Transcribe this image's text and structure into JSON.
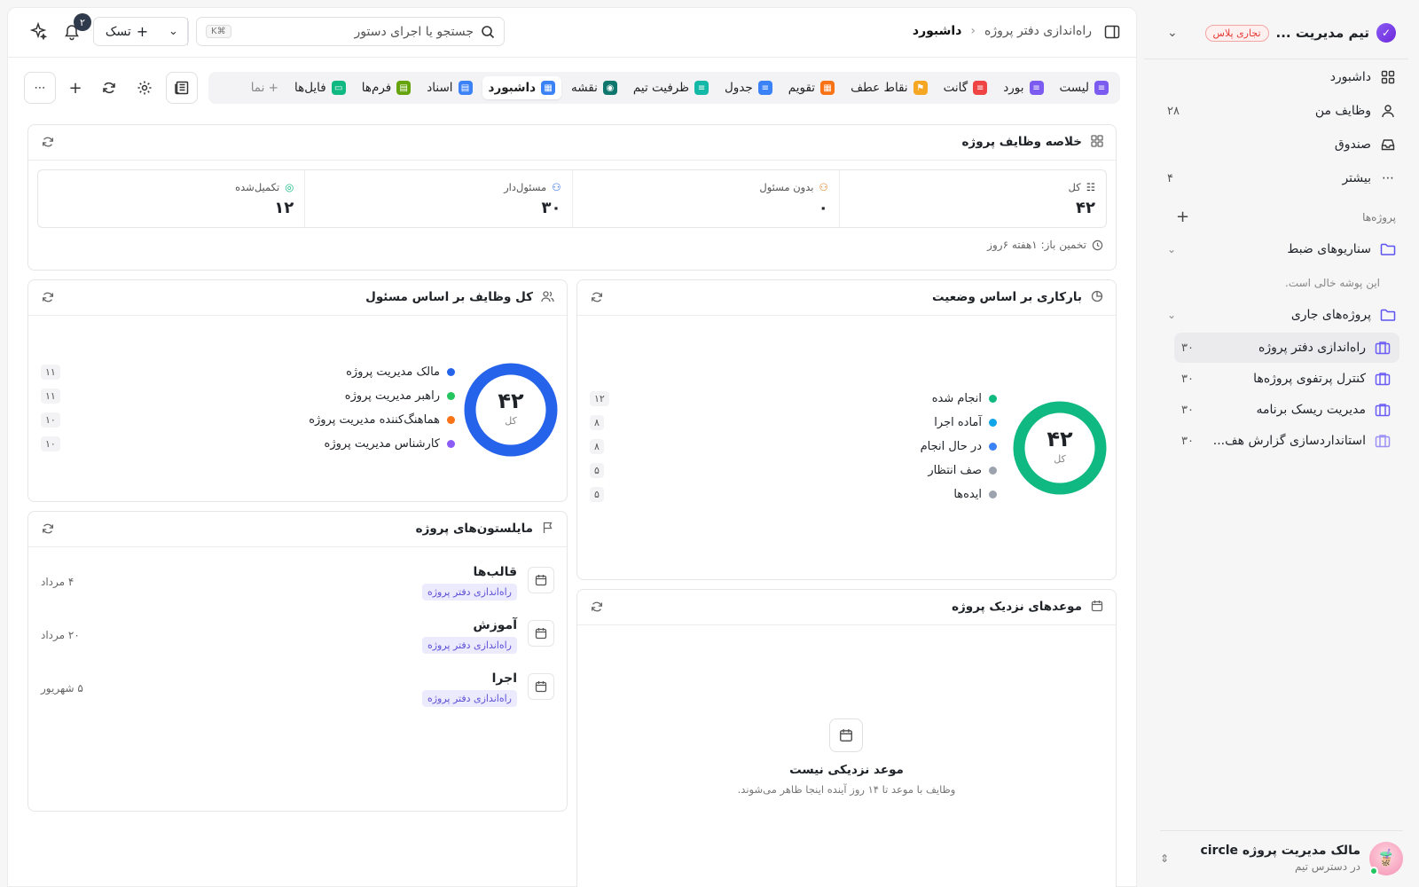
{
  "workspace": {
    "name": "تیم مدیریت ...",
    "badge": "تجاری پلاس"
  },
  "sidebar": {
    "nav": [
      {
        "label": "داشبورد",
        "count": ""
      },
      {
        "label": "وظایف من",
        "count": "۲۸"
      },
      {
        "label": "صندوق",
        "count": ""
      },
      {
        "label": "بیشتر",
        "count": "۴"
      }
    ],
    "projects_label": "پروژه‌ها",
    "folders": [
      {
        "label": "سناریوهای ضبط",
        "empty_note": "این پوشه خالی است."
      },
      {
        "label": "پروژه‌های جاری"
      }
    ],
    "projects": [
      {
        "label": "راه‌اندازی دفتر پروژه",
        "count": "۳۰"
      },
      {
        "label": "کنترل پرتفوی پروژه‌ها",
        "count": "۳۰"
      },
      {
        "label": "مدیریت ریسک برنامه",
        "count": "۳۰"
      },
      {
        "label": "استانداردسازی گزارش هف...",
        "count": "۳۰"
      }
    ],
    "user": {
      "name": "مالک مدیریت پروژه circle",
      "status": "در دسترس تیم"
    }
  },
  "topbar": {
    "breadcrumb": [
      "راه‌اندازی دفتر پروژه",
      "داشبورد"
    ],
    "search_placeholder": "جستجو یا اجرای دستور",
    "search_shortcut": "⌘K",
    "task_button": "تسک",
    "notification_count": "۲"
  },
  "tabs": [
    {
      "label": "لیست",
      "color": "#7c5cf0",
      "glyph": "≡"
    },
    {
      "label": "بورد",
      "color": "#7c5cf0",
      "glyph": "≡"
    },
    {
      "label": "گانت",
      "color": "#ef4444",
      "glyph": "≡"
    },
    {
      "label": "نقاط عطف",
      "color": "#f5a623",
      "glyph": "⚑"
    },
    {
      "label": "تقویم",
      "color": "#f97316",
      "glyph": "▦"
    },
    {
      "label": "جدول",
      "color": "#3b82f6",
      "glyph": "≡"
    },
    {
      "label": "ظرفیت تیم",
      "color": "#14b8a6",
      "glyph": "≡"
    },
    {
      "label": "نقشه",
      "color": "#0f766e",
      "glyph": "◉"
    },
    {
      "label": "داشبورد",
      "color": "#3b82f6",
      "glyph": "▦",
      "active": true
    },
    {
      "label": "اسناد",
      "color": "#3b82f6",
      "glyph": "▤"
    },
    {
      "label": "فرم‌ها",
      "color": "#65a30d",
      "glyph": "▤"
    },
    {
      "label": "فایل‌ها",
      "color": "#10b981",
      "glyph": "▭"
    },
    {
      "label": "+ نما",
      "color": "",
      "glyph": ""
    }
  ],
  "summary": {
    "title": "خلاصه وظایف پروژه",
    "stats": [
      {
        "label": "کل",
        "value": "۴۲"
      },
      {
        "label": "بدون مسئول",
        "value": "۰"
      },
      {
        "label": "مسئول‌دار",
        "value": "۳۰"
      },
      {
        "label": "تکمیل‌شده",
        "value": "۱۲"
      }
    ],
    "estimate": "تخمین باز: ۱هفته ۶روز"
  },
  "workload": {
    "title": "بارکاری بر اساس وضعیت",
    "total": "۴۲",
    "total_label": "کل",
    "color": "#10b981",
    "items": [
      {
        "label": "انجام شده",
        "count": "۱۲",
        "color": "#10b981"
      },
      {
        "label": "آماده اجرا",
        "count": "۸",
        "color": "#0ea5e9"
      },
      {
        "label": "در حال انجام",
        "count": "۸",
        "color": "#3b82f6"
      },
      {
        "label": "صف انتظار",
        "count": "۵",
        "color": "#9ca3af"
      },
      {
        "label": "ایده‌ها",
        "count": "۵",
        "color": "#9ca3af"
      }
    ]
  },
  "by_assignee": {
    "title": "کل وظایف بر اساس مسئول",
    "total": "۴۲",
    "total_label": "کل",
    "color": "#2563eb",
    "items": [
      {
        "label": "مالک مدیریت پروژه",
        "count": "۱۱",
        "color": "#2563eb"
      },
      {
        "label": "راهبر مدیریت پروژه",
        "count": "۱۱",
        "color": "#22c55e"
      },
      {
        "label": "هماهنگ‌کننده مدیریت پروژه",
        "count": "۱۰",
        "color": "#f97316"
      },
      {
        "label": "کارشناس مدیریت پروژه",
        "count": "۱۰",
        "color": "#8b5cf6"
      }
    ]
  },
  "milestones": {
    "title": "مایلستون‌های پروژه",
    "items": [
      {
        "title": "قالب‌ها",
        "tag": "راه‌اندازی دفتر پروژه",
        "date": "۴ مرداد"
      },
      {
        "title": "آموزش",
        "tag": "راه‌اندازی دفتر پروژه",
        "date": "۲۰ مرداد"
      },
      {
        "title": "اجرا",
        "tag": "راه‌اندازی دفتر پروژه",
        "date": "۵ شهریور"
      }
    ]
  },
  "deadlines": {
    "title": "موعدهای نزدیک پروژه",
    "empty_title": "موعد نزدیکی نیست",
    "empty_sub": "وظایف با موعد تا ۱۴ روز آینده اینجا ظاهر می‌شوند."
  }
}
